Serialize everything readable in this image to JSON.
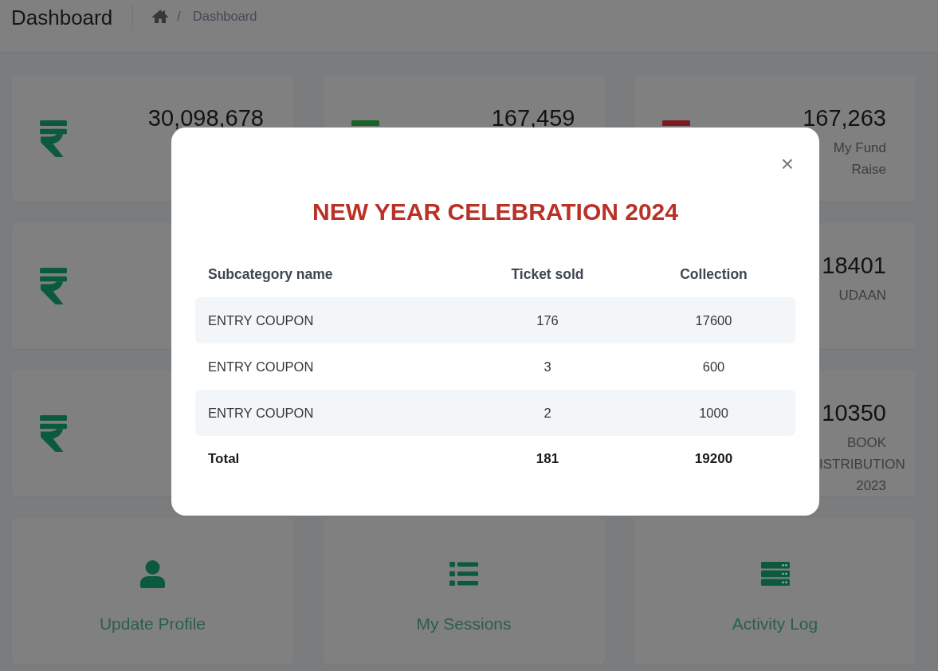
{
  "header": {
    "title": "Dashboard",
    "breadcrumb": {
      "separator": "/",
      "current": "Dashboard"
    }
  },
  "stat_columns": [
    [
      {
        "kind": "currency",
        "value": "30,098,678"
      },
      {
        "kind": "currency"
      },
      {
        "kind": "currency"
      }
    ],
    [
      {
        "kind": "marker",
        "color": "#186428",
        "value": "167,459"
      }
    ],
    [
      {
        "kind": "marker",
        "color": "#7d1b23",
        "value": "167,263",
        "label": "My Fund Raise"
      },
      {
        "kind": "plain",
        "value": "18401",
        "label": "UDAAN"
      },
      {
        "kind": "plain",
        "value": "10350",
        "label": "BOOK ISTRIBUTION 2023"
      }
    ]
  ],
  "actions": [
    {
      "kind": "profile",
      "label": "Update Profile"
    },
    {
      "kind": "sessions",
      "label": "My Sessions"
    },
    {
      "kind": "activity",
      "label": "Activity Log"
    }
  ],
  "modal": {
    "close": "×",
    "title": "NEW YEAR CELEBRATION 2024",
    "table": {
      "columns": [
        "Subcategory name",
        "Ticket sold",
        "Collection"
      ],
      "rows": [
        [
          "ENTRY COUPON",
          "176",
          "17600"
        ],
        [
          "ENTRY COUPON",
          "3",
          "600"
        ],
        [
          "ENTRY COUPON",
          "2",
          "1000"
        ]
      ],
      "total": [
        "Total",
        "181",
        "19200"
      ]
    }
  }
}
